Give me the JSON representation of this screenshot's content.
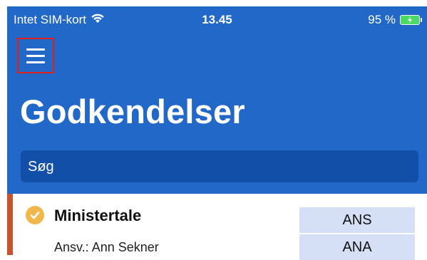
{
  "status_bar": {
    "carrier": "Intet SIM-kort",
    "time": "13.45",
    "battery": "95 %"
  },
  "header": {
    "title": "Godkendelser",
    "search_placeholder": "Søg"
  },
  "colors": {
    "header_bg": "#2268c8",
    "search_bg": "#124fa8",
    "accent_bar": "#c9512e",
    "check_badge": "#f0b84c",
    "tag_bg": "#d5dff5"
  },
  "items": [
    {
      "title": "Ministertale",
      "responsible": "Ansv.: Ann Sekner",
      "tags": [
        "ANS",
        "ANA"
      ],
      "icon": "check-circle-icon"
    }
  ]
}
